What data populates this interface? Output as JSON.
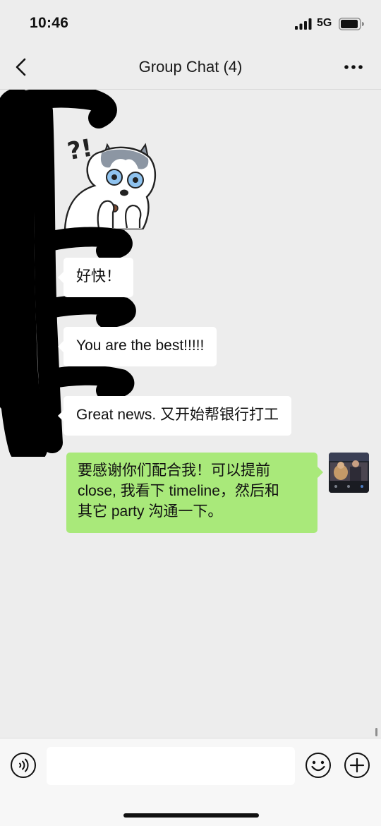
{
  "status_bar": {
    "time": "10:46",
    "network": "5G"
  },
  "nav": {
    "title": "Group Chat (4)"
  },
  "messages": [
    {
      "text": "好快！"
    },
    {
      "text": "You are the best!!!!!"
    },
    {
      "text": "Great news. 又开始帮银行打工"
    }
  ],
  "my_message": {
    "lines": [
      "要感谢你们配合我！可以提前",
      "close, 我看下 timeline，然后和",
      "其它 party 沟通一下。"
    ]
  },
  "sticker": {
    "exclaim": "?!"
  },
  "input": {
    "value": "",
    "placeholder": ""
  },
  "colors": {
    "background": "#ededed",
    "outgoing_bubble": "#a9e97a",
    "incoming_bubble": "#ffffff"
  },
  "icons": {
    "back": "chevron-left-icon",
    "more": "more-dots-icon",
    "voice": "voice-icon",
    "emoji": "emoji-icon",
    "plus": "plus-icon"
  }
}
